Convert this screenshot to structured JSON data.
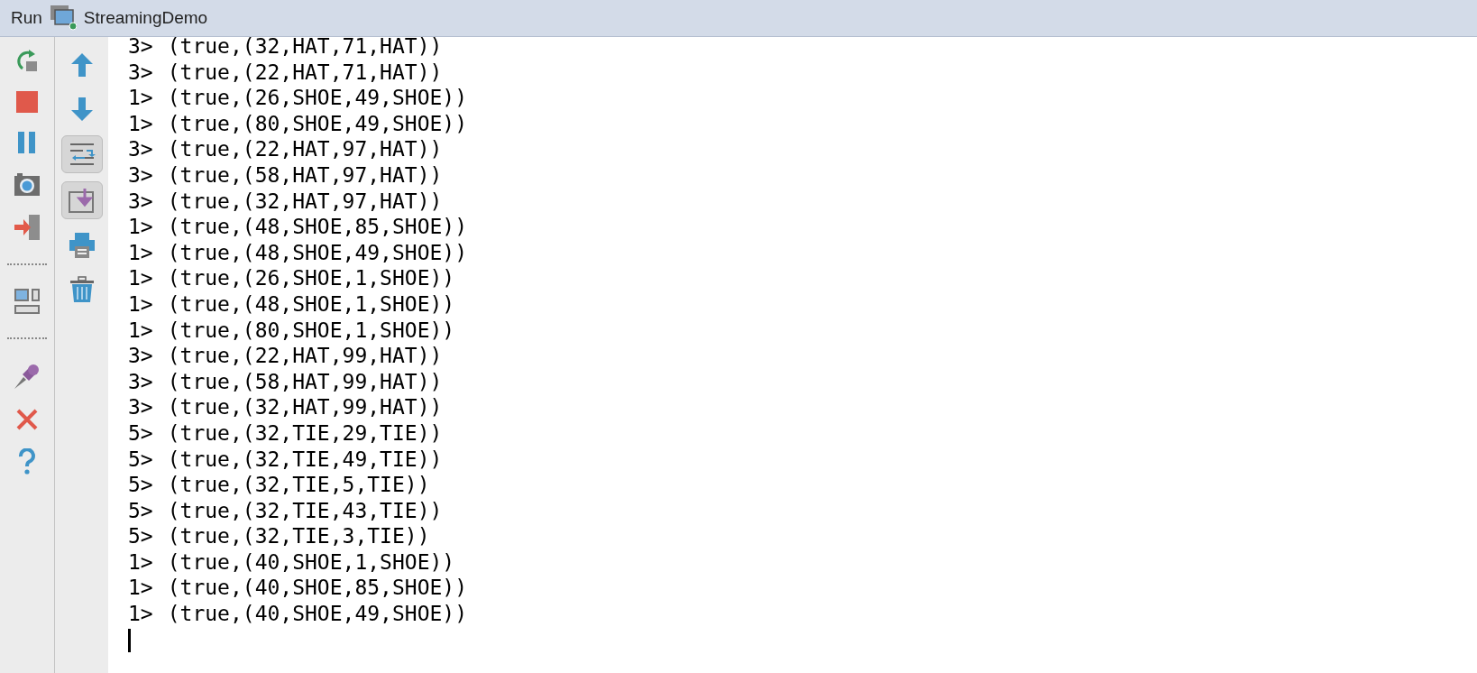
{
  "title_bar": {
    "label": "Run",
    "configuration": "StreamingDemo"
  },
  "left_toolbar": [
    {
      "kind": "rerun"
    },
    {
      "kind": "stop"
    },
    {
      "kind": "pause"
    },
    {
      "kind": "camera"
    },
    {
      "kind": "exit"
    },
    {
      "kind": "separator"
    },
    {
      "kind": "layout"
    },
    {
      "kind": "separator"
    },
    {
      "kind": "pin"
    },
    {
      "kind": "close"
    },
    {
      "kind": "help"
    }
  ],
  "right_toolbar": [
    {
      "kind": "up",
      "on": false
    },
    {
      "kind": "down",
      "on": false
    },
    {
      "kind": "wrap",
      "on": true
    },
    {
      "kind": "scroll_end",
      "on": true
    },
    {
      "kind": "print",
      "on": false
    },
    {
      "kind": "trash",
      "on": false
    }
  ],
  "console_lines": [
    {
      "prefix": "3>",
      "text": "(true,(32,HAT,71,HAT))"
    },
    {
      "prefix": "3>",
      "text": "(true,(22,HAT,71,HAT))"
    },
    {
      "prefix": "1>",
      "text": "(true,(26,SHOE,49,SHOE))"
    },
    {
      "prefix": "1>",
      "text": "(true,(80,SHOE,49,SHOE))"
    },
    {
      "prefix": "3>",
      "text": "(true,(22,HAT,97,HAT))"
    },
    {
      "prefix": "3>",
      "text": "(true,(58,HAT,97,HAT))"
    },
    {
      "prefix": "3>",
      "text": "(true,(32,HAT,97,HAT))"
    },
    {
      "prefix": "1>",
      "text": "(true,(48,SHOE,85,SHOE))"
    },
    {
      "prefix": "1>",
      "text": "(true,(48,SHOE,49,SHOE))"
    },
    {
      "prefix": "1>",
      "text": "(true,(26,SHOE,1,SHOE))"
    },
    {
      "prefix": "1>",
      "text": "(true,(48,SHOE,1,SHOE))"
    },
    {
      "prefix": "1>",
      "text": "(true,(80,SHOE,1,SHOE))"
    },
    {
      "prefix": "3>",
      "text": "(true,(22,HAT,99,HAT))"
    },
    {
      "prefix": "3>",
      "text": "(true,(58,HAT,99,HAT))"
    },
    {
      "prefix": "3>",
      "text": "(true,(32,HAT,99,HAT))"
    },
    {
      "prefix": "5>",
      "text": "(true,(32,TIE,29,TIE))"
    },
    {
      "prefix": "5>",
      "text": "(true,(32,TIE,49,TIE))"
    },
    {
      "prefix": "5>",
      "text": "(true,(32,TIE,5,TIE))"
    },
    {
      "prefix": "5>",
      "text": "(true,(32,TIE,43,TIE))"
    },
    {
      "prefix": "5>",
      "text": "(true,(32,TIE,3,TIE))"
    },
    {
      "prefix": "1>",
      "text": "(true,(40,SHOE,1,SHOE))"
    },
    {
      "prefix": "1>",
      "text": "(true,(40,SHOE,85,SHOE))"
    },
    {
      "prefix": "1>",
      "text": "(true,(40,SHOE,49,SHOE))"
    }
  ]
}
